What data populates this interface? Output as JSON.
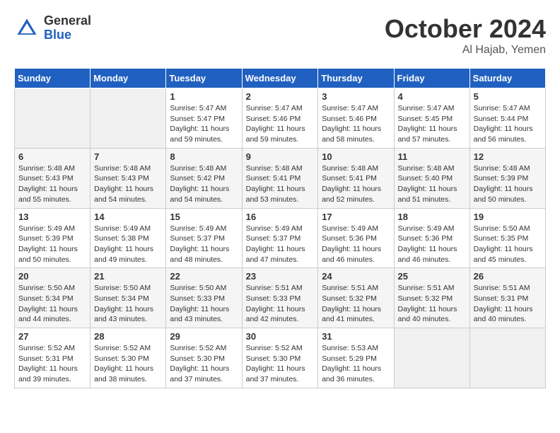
{
  "header": {
    "logo_general": "General",
    "logo_blue": "Blue",
    "title": "October 2024",
    "location": "Al Hajab, Yemen"
  },
  "columns": [
    "Sunday",
    "Monday",
    "Tuesday",
    "Wednesday",
    "Thursday",
    "Friday",
    "Saturday"
  ],
  "weeks": [
    [
      {
        "day": "",
        "info": ""
      },
      {
        "day": "",
        "info": ""
      },
      {
        "day": "1",
        "sunrise": "Sunrise: 5:47 AM",
        "sunset": "Sunset: 5:47 PM",
        "daylight": "Daylight: 11 hours and 59 minutes."
      },
      {
        "day": "2",
        "sunrise": "Sunrise: 5:47 AM",
        "sunset": "Sunset: 5:46 PM",
        "daylight": "Daylight: 11 hours and 59 minutes."
      },
      {
        "day": "3",
        "sunrise": "Sunrise: 5:47 AM",
        "sunset": "Sunset: 5:46 PM",
        "daylight": "Daylight: 11 hours and 58 minutes."
      },
      {
        "day": "4",
        "sunrise": "Sunrise: 5:47 AM",
        "sunset": "Sunset: 5:45 PM",
        "daylight": "Daylight: 11 hours and 57 minutes."
      },
      {
        "day": "5",
        "sunrise": "Sunrise: 5:47 AM",
        "sunset": "Sunset: 5:44 PM",
        "daylight": "Daylight: 11 hours and 56 minutes."
      }
    ],
    [
      {
        "day": "6",
        "sunrise": "Sunrise: 5:48 AM",
        "sunset": "Sunset: 5:43 PM",
        "daylight": "Daylight: 11 hours and 55 minutes."
      },
      {
        "day": "7",
        "sunrise": "Sunrise: 5:48 AM",
        "sunset": "Sunset: 5:43 PM",
        "daylight": "Daylight: 11 hours and 54 minutes."
      },
      {
        "day": "8",
        "sunrise": "Sunrise: 5:48 AM",
        "sunset": "Sunset: 5:42 PM",
        "daylight": "Daylight: 11 hours and 54 minutes."
      },
      {
        "day": "9",
        "sunrise": "Sunrise: 5:48 AM",
        "sunset": "Sunset: 5:41 PM",
        "daylight": "Daylight: 11 hours and 53 minutes."
      },
      {
        "day": "10",
        "sunrise": "Sunrise: 5:48 AM",
        "sunset": "Sunset: 5:41 PM",
        "daylight": "Daylight: 11 hours and 52 minutes."
      },
      {
        "day": "11",
        "sunrise": "Sunrise: 5:48 AM",
        "sunset": "Sunset: 5:40 PM",
        "daylight": "Daylight: 11 hours and 51 minutes."
      },
      {
        "day": "12",
        "sunrise": "Sunrise: 5:48 AM",
        "sunset": "Sunset: 5:39 PM",
        "daylight": "Daylight: 11 hours and 50 minutes."
      }
    ],
    [
      {
        "day": "13",
        "sunrise": "Sunrise: 5:49 AM",
        "sunset": "Sunset: 5:39 PM",
        "daylight": "Daylight: 11 hours and 50 minutes."
      },
      {
        "day": "14",
        "sunrise": "Sunrise: 5:49 AM",
        "sunset": "Sunset: 5:38 PM",
        "daylight": "Daylight: 11 hours and 49 minutes."
      },
      {
        "day": "15",
        "sunrise": "Sunrise: 5:49 AM",
        "sunset": "Sunset: 5:37 PM",
        "daylight": "Daylight: 11 hours and 48 minutes."
      },
      {
        "day": "16",
        "sunrise": "Sunrise: 5:49 AM",
        "sunset": "Sunset: 5:37 PM",
        "daylight": "Daylight: 11 hours and 47 minutes."
      },
      {
        "day": "17",
        "sunrise": "Sunrise: 5:49 AM",
        "sunset": "Sunset: 5:36 PM",
        "daylight": "Daylight: 11 hours and 46 minutes."
      },
      {
        "day": "18",
        "sunrise": "Sunrise: 5:49 AM",
        "sunset": "Sunset: 5:36 PM",
        "daylight": "Daylight: 11 hours and 46 minutes."
      },
      {
        "day": "19",
        "sunrise": "Sunrise: 5:50 AM",
        "sunset": "Sunset: 5:35 PM",
        "daylight": "Daylight: 11 hours and 45 minutes."
      }
    ],
    [
      {
        "day": "20",
        "sunrise": "Sunrise: 5:50 AM",
        "sunset": "Sunset: 5:34 PM",
        "daylight": "Daylight: 11 hours and 44 minutes."
      },
      {
        "day": "21",
        "sunrise": "Sunrise: 5:50 AM",
        "sunset": "Sunset: 5:34 PM",
        "daylight": "Daylight: 11 hours and 43 minutes."
      },
      {
        "day": "22",
        "sunrise": "Sunrise: 5:50 AM",
        "sunset": "Sunset: 5:33 PM",
        "daylight": "Daylight: 11 hours and 43 minutes."
      },
      {
        "day": "23",
        "sunrise": "Sunrise: 5:51 AM",
        "sunset": "Sunset: 5:33 PM",
        "daylight": "Daylight: 11 hours and 42 minutes."
      },
      {
        "day": "24",
        "sunrise": "Sunrise: 5:51 AM",
        "sunset": "Sunset: 5:32 PM",
        "daylight": "Daylight: 11 hours and 41 minutes."
      },
      {
        "day": "25",
        "sunrise": "Sunrise: 5:51 AM",
        "sunset": "Sunset: 5:32 PM",
        "daylight": "Daylight: 11 hours and 40 minutes."
      },
      {
        "day": "26",
        "sunrise": "Sunrise: 5:51 AM",
        "sunset": "Sunset: 5:31 PM",
        "daylight": "Daylight: 11 hours and 40 minutes."
      }
    ],
    [
      {
        "day": "27",
        "sunrise": "Sunrise: 5:52 AM",
        "sunset": "Sunset: 5:31 PM",
        "daylight": "Daylight: 11 hours and 39 minutes."
      },
      {
        "day": "28",
        "sunrise": "Sunrise: 5:52 AM",
        "sunset": "Sunset: 5:30 PM",
        "daylight": "Daylight: 11 hours and 38 minutes."
      },
      {
        "day": "29",
        "sunrise": "Sunrise: 5:52 AM",
        "sunset": "Sunset: 5:30 PM",
        "daylight": "Daylight: 11 hours and 37 minutes."
      },
      {
        "day": "30",
        "sunrise": "Sunrise: 5:52 AM",
        "sunset": "Sunset: 5:30 PM",
        "daylight": "Daylight: 11 hours and 37 minutes."
      },
      {
        "day": "31",
        "sunrise": "Sunrise: 5:53 AM",
        "sunset": "Sunset: 5:29 PM",
        "daylight": "Daylight: 11 hours and 36 minutes."
      },
      {
        "day": "",
        "info": ""
      },
      {
        "day": "",
        "info": ""
      }
    ]
  ]
}
